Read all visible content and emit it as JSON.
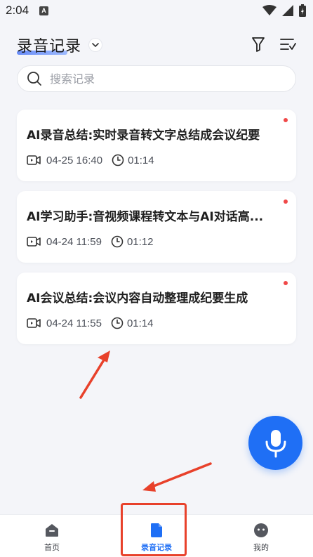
{
  "status_bar": {
    "time": "2:04",
    "app_badge": "A"
  },
  "header": {
    "title": "录音记录"
  },
  "search": {
    "placeholder": "搜索记录"
  },
  "records": [
    {
      "title": "AI录音总结:实时录音转文字总结成会议纪要",
      "date": "04-25 16:40",
      "duration": "01:14"
    },
    {
      "title": "AI学习助手:音视频课程转文本与AI对话高...",
      "date": "04-24 11:59",
      "duration": "01:12"
    },
    {
      "title": "AI会议总结:会议内容自动整理成纪要生成",
      "date": "04-24 11:55",
      "duration": "01:14"
    }
  ],
  "bottom_nav": {
    "items": [
      {
        "label": "首页",
        "icon": "home-icon"
      },
      {
        "label": "录音记录",
        "icon": "document-icon"
      },
      {
        "label": "我的",
        "icon": "profile-icon"
      }
    ]
  },
  "colors": {
    "accent": "#1f6ff5",
    "unread": "#f04848",
    "annotation": "#e8412b",
    "background": "#f4f5f9"
  }
}
